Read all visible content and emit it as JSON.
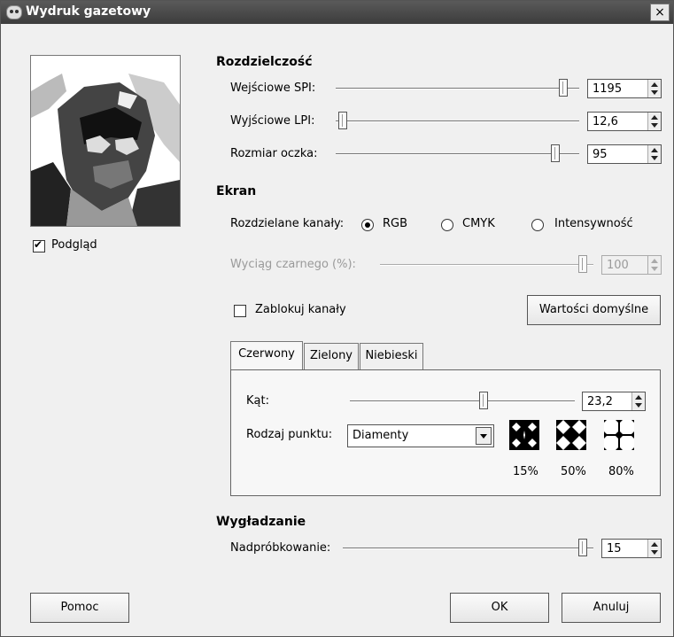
{
  "window": {
    "title": "Wydruk gazetowy",
    "close": "×"
  },
  "preview": {
    "checkbox_label": "Podgląd",
    "checked": true
  },
  "resolution": {
    "title": "Rozdzielczość",
    "input_spi": {
      "label": "Wejściowe SPI:",
      "value": "1195"
    },
    "output_lpi": {
      "label": "Wyjściowe LPI:",
      "value": "12,6"
    },
    "cell_size": {
      "label": "Rozmiar oczka:",
      "value": "95"
    }
  },
  "screen": {
    "title": "Ekran",
    "channels_label": "Rozdzielane kanały:",
    "options": [
      "RGB",
      "CMYK",
      "Intensywność"
    ],
    "selected": "RGB",
    "black_pullout": {
      "label": "Wyciąg czarnego (%):",
      "value": "100"
    },
    "lock_label": "Zablokuj kanały",
    "defaults_button": "Wartości domyślne",
    "tabs": [
      "Czerwony",
      "Zielony",
      "Niebieski"
    ],
    "active_tab": "Czerwony",
    "angle": {
      "label": "Kąt:",
      "value": "23,2"
    },
    "spot_type": {
      "label": "Rodzaj punktu:",
      "value": "Diamenty"
    },
    "swatches": [
      "15%",
      "50%",
      "80%"
    ]
  },
  "antialias": {
    "title": "Wygładzanie",
    "oversample": {
      "label": "Nadpróbkowanie:",
      "value": "15"
    }
  },
  "buttons": {
    "help": "Pomoc",
    "ok": "OK",
    "cancel": "Anuluj"
  }
}
